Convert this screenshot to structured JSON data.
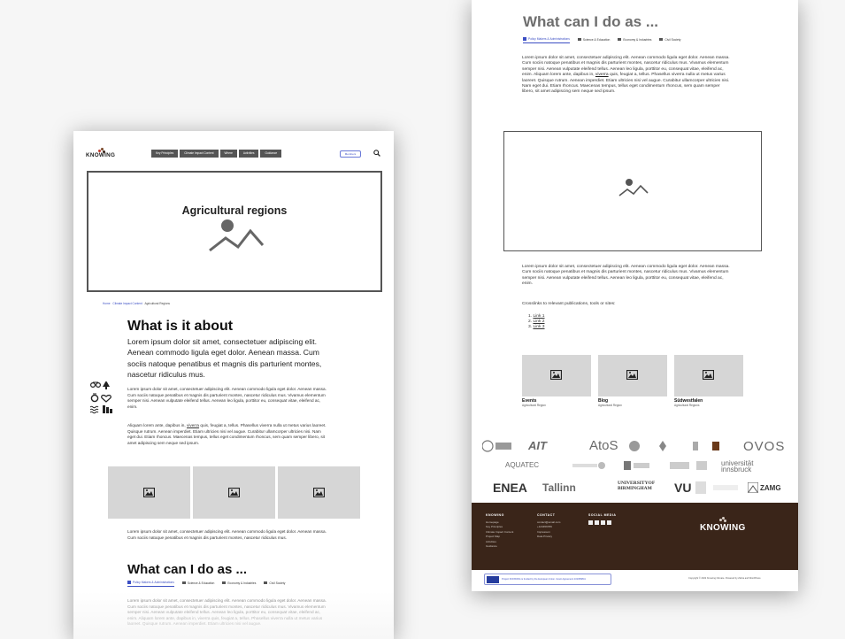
{
  "brand": {
    "name": "KNOWING"
  },
  "left_page": {
    "nav": [
      "Key Principles",
      "Climate Impact Content",
      "Where",
      "Activities",
      "Guidance"
    ],
    "members_button": "Members",
    "hero_title": "Agricultural regions",
    "breadcrumb": [
      "Home",
      "Climate Impact Content",
      "Agricultural Regions"
    ],
    "heading_about": "What is it about",
    "lead": "Lorem ipsum dolor sit amet, consectetuer adipiscing elit. Aenean commodo ligula eget dolor. Aenean massa. Cum sociis natoque penatibus et magnis dis parturient montes, nascetur ridiculus mus.",
    "para1": "Lorem ipsum dolor sit amet, consectetuer adipiscing elit. Aenean commodo ligula eget dolor. Aenean massa. Cum sociis natoque penatibus et magnis dis parturient montes, nascetur ridiculus mus. Vivamus elementum semper nisi. Aenean vulputate eleifend tellus. Aenean leo ligula, porttitor eu, consequat vitae, eleifend ac, enim.",
    "para2_a": "Aliquam lorem ante, dapibus in, ",
    "para2_link": "viverra",
    "para2_b": " quis, feugiat a, tellus. Phasellus viverra nulla ut metus varius laoreet. Quisque rutrum. Aenean imperdiet. Etiam ultricies nisi vel augue. Curabitur ullamcorper ultricies nisi. Nam eget dui. Etiam rhoncus. Maecenas tempus, tellus eget condimentum rhoncus, sem quam semper libero, sit amet adipiscing sem neque sed ipsum.",
    "para3": "Lorem ipsum dolor sit amet, consectetuer adipiscing elit. Aenean commodo ligula eget dolor. Aenean massa. Cum sociis natoque penatibus et magnis dis parturient montes, nascetur ridiculus mus.",
    "heading_what": "What can I do as ...",
    "para4": "Lorem ipsum dolor sit amet, consectetuer adipiscing elit. Aenean commodo ligula eget dolor. Aenean massa. Cum sociis natoque penatibus et magnis dis parturient montes, nascetur ridiculus mus. Vivamus elementum semper nisi. Aenean vulputate eleifend tellus. Aenean leo ligula, porttitor eu, consequat vitae, eleifend ac, enim. Aliquam lorem ante, dapibus in, viverra quis, feugiat a, tellus. Phasellus viverra nulla ut metus varius laoreet. Quisque rutrum. Aenean imperdiet. Etiam ultricies nisi vel augue."
  },
  "tabs": [
    "Policy Makers & Administrations",
    "Science & Education",
    "Economy & Industries",
    "Civil Society"
  ],
  "right_page": {
    "heading": "What can I do as ...",
    "para1_a": "Lorem ipsum dolor sit amet, consectetuer adipiscing elit. Aenean commodo ligula eget dolor. Aenean massa. Cum sociis natoque penatibus et magnis dis parturient montes, nascetur ridiculus mus. Vivamus elementum semper nisi. Aenean vulputate eleifend tellus. Aenean leo ligula, porttitor eu, consequat vitae, eleifend ac, enim. Aliquam lorem ante, dapibus in, ",
    "para1_link": "viverra",
    "para1_b": " quis, feugiat a, tellus. Phasellus viverra nulla ut metus varius laoreet. Quisque rutrum. Aenean imperdiet. Etiam ultricies nisi vel augue. Curabitur ullamcorper ultricies nisi. Nam eget dui. Etiam rhoncus. Maecenas tempus, tellus eget condimentum rhoncus, sem quam semper libero, sit amet adipiscing sem neque sed ipsum.",
    "para2": "Lorem ipsum dolor sit amet, consectetuer adipiscing elit. Aenean commodo ligula eget dolor. Aenean massa. Cum sociis natoque penatibus et magnis dis parturient montes, nascetur ridiculus mus. Vivamus elementum semper nisi. Aenean vulputate eleifend tellus. Aenean leo ligula, porttitor eu, consequat vitae, eleifend ac, enim.",
    "crosslinks": "Crosslinks to relevant publications, tools or sites:",
    "links": [
      "Link 1",
      "Link 2",
      "Link 3"
    ],
    "cards": [
      {
        "title": "Events",
        "sub": "Agricultural Region"
      },
      {
        "title": "Blog",
        "sub": "Agricultural Region"
      },
      {
        "title": "Südwestfalen",
        "sub": "Agricultural Regions"
      }
    ],
    "partners": {
      "row1": [
        "AIT",
        "AtoS",
        "OVOS"
      ],
      "row2": [
        "AQUATEC",
        "universität innsbruck"
      ],
      "row3": [
        "ENEA",
        "Tallinn",
        "UNIVERSITYOF BIRMINGHAM",
        "VU",
        "ZAMG"
      ]
    },
    "footer": {
      "col1_head": "KNOWING",
      "col1_items": [
        "Homepage",
        "Key Principles",
        "Climate Impact Content",
        "Project Map",
        "Activities",
        "Guidance"
      ],
      "col2_head": "CONTACT",
      "col2_items": [
        "contact@email.com",
        "+123456789",
        "Impressum",
        "Data Privacy"
      ],
      "col3_head": "SOCIAL MEDIA",
      "brand": "KNOWING"
    },
    "eu_text": "Project KNOWING is funded by the European Union. Grant Agreement 101056841",
    "copyright": "Copyright © 2022 Knowing Climate. Powered by Zahra and WordPress"
  }
}
